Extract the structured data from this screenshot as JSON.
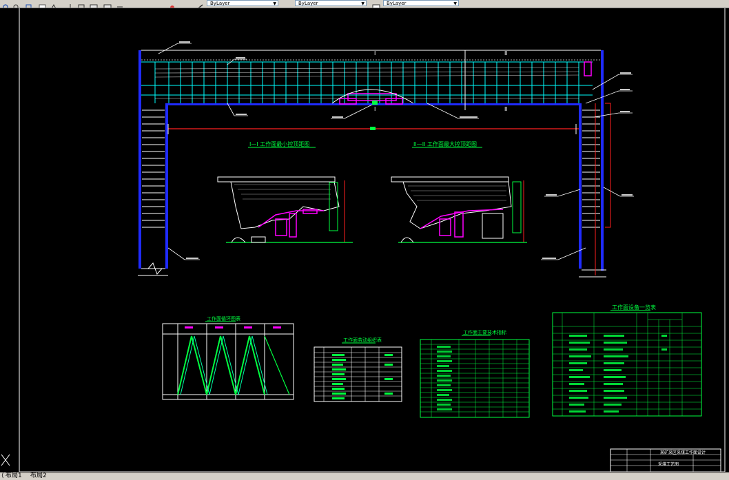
{
  "toolbar": {
    "layer_combo_value": "ByLayer",
    "linetype_combo_value": "ByLayer",
    "lineweight_combo_value": "ByLayer"
  },
  "drawing": {
    "section_label_left": "I—I 工作面最小控顶距图",
    "section_label_right": "II—II 工作面最大控顶距图",
    "section_mark_I": "I",
    "section_mark_II": "II",
    "chart_title": "工作面循环图表",
    "table1_title": "工作面劳动组织表",
    "table2_title": "工作面主要技术指标",
    "equipment_table_title": "工作面设备一览表",
    "title_block_project": "某矿采区采煤工作面设计",
    "title_block_drawing": "采煤工艺图"
  },
  "layout_tabs": [
    "布局1",
    "布局2"
  ],
  "colors": {
    "background": "#000000",
    "roadway": "#1f2bff",
    "support": "#00ffff",
    "equipment": "#ff00ff",
    "table": "#00ff40",
    "redline": "#ff2020"
  }
}
